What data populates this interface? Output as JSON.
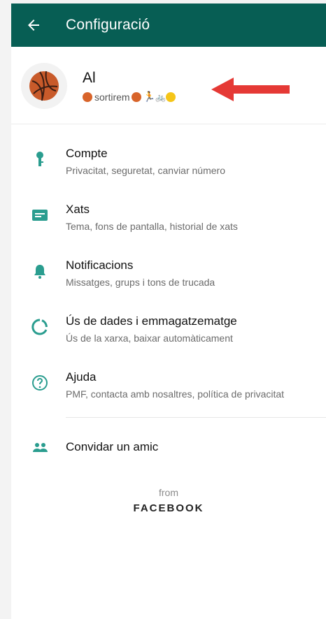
{
  "appbar": {
    "title": "Configuració"
  },
  "profile": {
    "name": "Al",
    "status_text": "sortirem"
  },
  "settings": {
    "items": [
      {
        "title": "Compte",
        "subtitle": "Privacitat, seguretat, canviar número"
      },
      {
        "title": "Xats",
        "subtitle": "Tema, fons de pantalla, historial de xats"
      },
      {
        "title": "Notificacions",
        "subtitle": "Missatges, grups i tons de trucada"
      },
      {
        "title": "Ús de dades i emmagatzematge",
        "subtitle": "Ús de la xarxa, baixar automàticament"
      },
      {
        "title": "Ajuda",
        "subtitle": "PMF, contacta amb nosaltres, política de privacitat"
      }
    ],
    "invite": "Convidar un amic"
  },
  "footer": {
    "from": "from",
    "brand": "FACEBOOK"
  },
  "colors": {
    "header": "#075e54",
    "icon": "#2a9d8f",
    "accent_arrow": "#e53935"
  }
}
